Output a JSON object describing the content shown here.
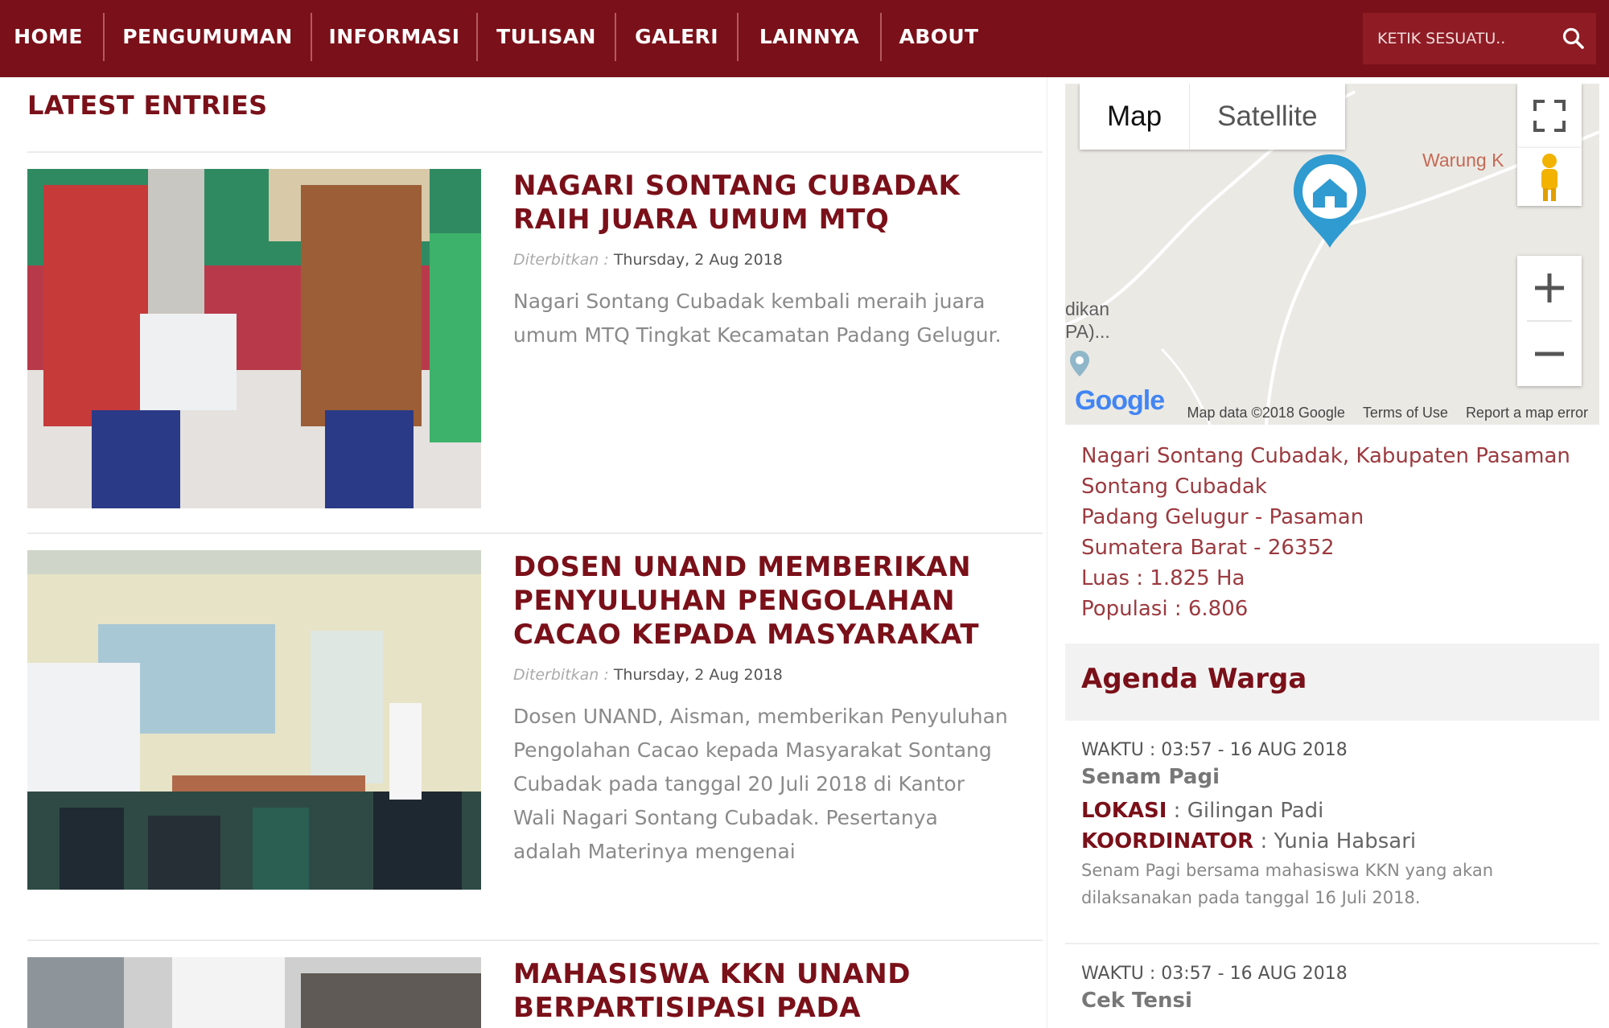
{
  "nav": {
    "items": [
      {
        "label": "HOME"
      },
      {
        "label": "PENGUMUMAN"
      },
      {
        "label": "INFORMASI"
      },
      {
        "label": "TULISAN"
      },
      {
        "label": "GALERI"
      },
      {
        "label": "LAINNYA"
      },
      {
        "label": "ABOUT"
      }
    ],
    "search_placeholder": "KETIK SESUATU..",
    "search_icon": "search-icon"
  },
  "colors": {
    "brand": "#7a1019",
    "accent_text": "#9b3a3f"
  },
  "main": {
    "section_title": "LATEST ENTRIES",
    "entries": [
      {
        "title": "NAGARI SONTANG CUBADAK RAIH JUARA UMUM MTQ",
        "meta_label": "Diterbitkan :",
        "date": "Thursday, 2 Aug 2018",
        "excerpt": "Nagari Sontang Cubadak kembali meraih juara umum MTQ Tingkat Kecamatan Padang Gelugur."
      },
      {
        "title": "DOSEN UNAND MEMBERIKAN PENYULUHAN PENGOLAHAN CACAO KEPADA MASYARAKAT",
        "meta_label": "Diterbitkan :",
        "date": "Thursday, 2 Aug 2018",
        "excerpt": "Dosen UNAND, Aisman,  memberikan Penyuluhan Pengolahan Cacao kepada Masyarakat Sontang Cubadak pada tanggal 20 Juli 2018 di Kantor Wali Nagari Sontang Cubadak. Pesertanya adalah Materinya mengenai"
      },
      {
        "title": "MAHASISWA KKN UNAND BERPARTISIPASI PADA PUSKESMAS"
      }
    ]
  },
  "map": {
    "type_map": "Map",
    "type_satellite": "Satellite",
    "place_label": "Warung K",
    "side_label_1": "dikan",
    "side_label_2": "PA)...",
    "google": "Google",
    "footer_data": "Map data ©2018 Google",
    "footer_terms": "Terms of Use",
    "footer_report": "Report a map error"
  },
  "sidebar": {
    "address": [
      "Nagari Sontang Cubadak, Kabupaten Pasaman",
      "Sontang Cubadak",
      "Padang Gelugur - Pasaman",
      "Sumatera Barat - 26352",
      "Luas : 1.825 Ha",
      "Populasi : 6.806"
    ],
    "agenda_title": "Agenda Warga",
    "agenda": [
      {
        "time": "WAKTU : 03:57 - 16 AUG 2018",
        "name": "Senam Pagi",
        "lokasi_label": "LOKASI",
        "lokasi": " : Gilingan Padi",
        "koord_label": "KOORDINATOR",
        "koord": " : Yunia Habsari",
        "desc": "Senam Pagi bersama mahasiswa KKN yang akan dilaksanakan pada tanggal 16 Juli 2018."
      },
      {
        "time": "WAKTU : 03:57 - 16 AUG 2018",
        "name": "Cek Tensi"
      }
    ]
  }
}
